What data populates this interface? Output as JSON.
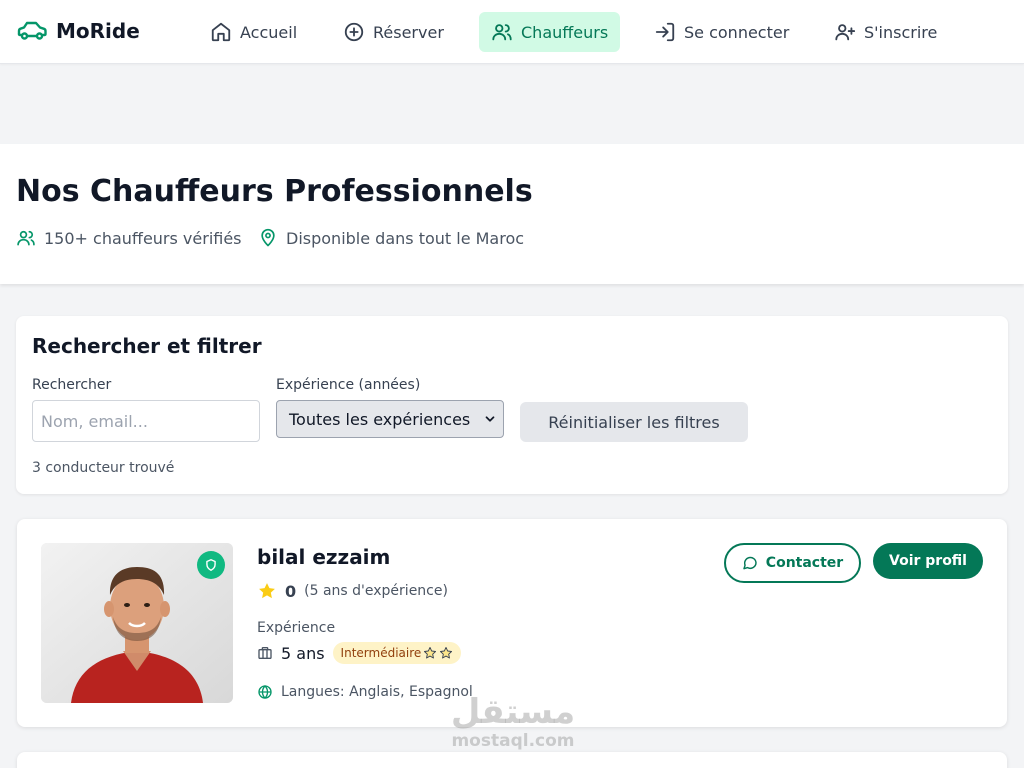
{
  "brand": {
    "name": "MoRide",
    "icon": "car-icon"
  },
  "nav": {
    "items": [
      {
        "label": "Accueil",
        "icon": "home-icon"
      },
      {
        "label": "Réserver",
        "icon": "plus-circle-icon"
      },
      {
        "label": "Chauffeurs",
        "icon": "users-icon",
        "active": true
      },
      {
        "label": "Se connecter",
        "icon": "login-icon"
      },
      {
        "label": "S'inscrire",
        "icon": "user-plus-icon"
      }
    ]
  },
  "hero": {
    "title": "Nos Chauffeurs Professionnels",
    "drivers_count": "150+ chauffeurs vérifiés",
    "availability": "Disponible dans tout le Maroc"
  },
  "filters": {
    "title": "Rechercher et filtrer",
    "search_label": "Rechercher",
    "search_placeholder": "Nom, email...",
    "search_value": "",
    "experience_label": "Expérience (années)",
    "experience_selected": "Toutes les expériences",
    "reset_label": "Réinitialiser les filtres",
    "result_count": "3 conducteur trouvé"
  },
  "drivers": [
    {
      "name": "bilal ezzaim",
      "rating": "0",
      "rating_experience": "(5 ans d'expérience)",
      "experience_label": "Expérience",
      "experience_years": "5 ans",
      "level": "Intermédiaire",
      "level_stars": "2",
      "languages": "Langues: Anglais, Espagnol",
      "verified": true,
      "contact_label": "Contacter",
      "profile_label": "Voir profil"
    }
  ],
  "watermark": {
    "arabic": "مستقل",
    "latin": "mostaql.com"
  },
  "colors": {
    "accent": "#047857",
    "accent_light": "#d1fae5",
    "verified": "#10b981",
    "badge_bg": "#fef3c7",
    "star": "#facc15"
  }
}
